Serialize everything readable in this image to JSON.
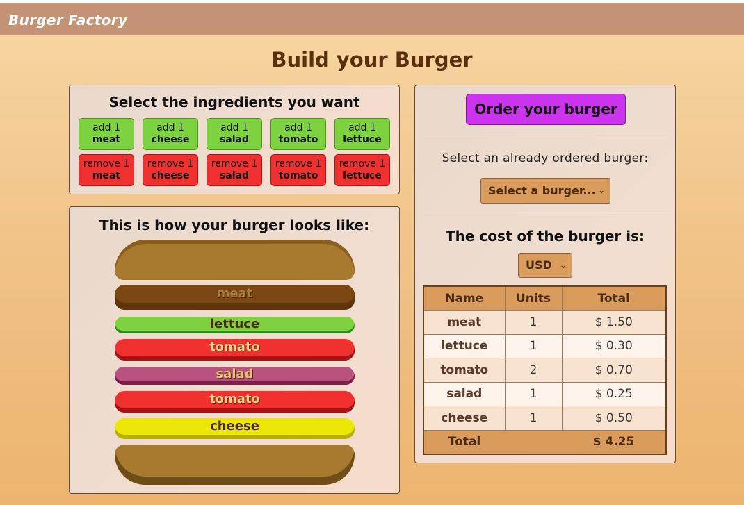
{
  "app": {
    "brand": "Burger Factory"
  },
  "page": {
    "title": "Build your Burger"
  },
  "ingredients_panel": {
    "heading": "Select the ingredients you want",
    "add_prefix": "add 1",
    "remove_prefix": "remove 1",
    "ingredients": [
      "meat",
      "cheese",
      "salad",
      "tomato",
      "lettuce"
    ]
  },
  "preview_panel": {
    "heading": "This is how your burger looks like:",
    "layers": [
      "meat",
      "lettuce",
      "tomato",
      "salad",
      "tomato",
      "cheese"
    ]
  },
  "order_panel": {
    "order_button": "Order your burger",
    "select_label": "Select an already ordered burger:",
    "burger_select_value": "Select a burger...",
    "cost_label": "The cost of the burger is:",
    "currency_value": "USD",
    "table": {
      "headers": [
        "Name",
        "Units",
        "Total"
      ],
      "rows": [
        {
          "name": "meat",
          "units": "1",
          "total": "$ 1.50"
        },
        {
          "name": "lettuce",
          "units": "1",
          "total": "$ 0.30"
        },
        {
          "name": "tomato",
          "units": "2",
          "total": "$ 0.70"
        },
        {
          "name": "salad",
          "units": "1",
          "total": "$ 0.25"
        },
        {
          "name": "cheese",
          "units": "1",
          "total": "$ 0.50"
        }
      ],
      "total_label": "Total",
      "total_value": "$ 4.25"
    }
  },
  "colors": {
    "navbar": "#c49274",
    "add_button": "#7dd33f",
    "remove_button": "#f0312f",
    "order_button": "#cc33ee",
    "select": "#d99c5d",
    "title": "#5c2f0c"
  },
  "icons": {
    "dropdown": "chevron-down-icon"
  }
}
